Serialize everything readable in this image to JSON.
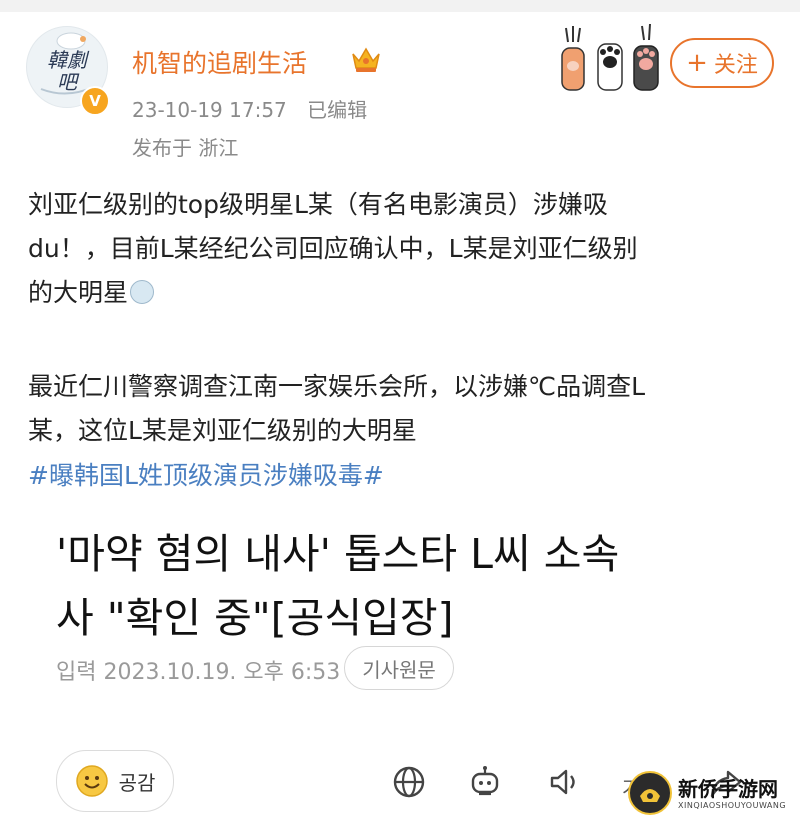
{
  "colors": {
    "accent": "#e8742c",
    "link": "#4a7fc1",
    "muted": "#8a8a8a"
  },
  "author": {
    "avatar_text": "韓劇\n吧",
    "verified_badge": "V",
    "name": "机智的追剧生活",
    "crown_icon": "crown-icon",
    "timestamp": "23-10-19 17:57",
    "edited": "已编辑",
    "location": "发布于 浙江"
  },
  "follow_button": {
    "plus": "+",
    "label": "关注"
  },
  "post": {
    "lines": [
      "刘亚仁级别的top级明星L某（有名电影演员）涉嫌吸",
      "du！，目前L某经纪公司回应确认中，L某是刘亚仁级别",
      "的大明星",
      "最近仁川警察调查江南一家娱乐会所，以涉嫌℃品调查L",
      "某，这位L某是刘亚仁级别的大明星"
    ],
    "hashtag": "#曝韩国L姓顶级演员涉嫌吸毒#"
  },
  "article": {
    "headline_line1": "'마약 혐의 내사' 톱스타 L씨 소속",
    "headline_line2": "사 \"확인 중\"[공식입장]",
    "date": "입력 2023.10.19. 오후 6:53",
    "original_button": "기사원문"
  },
  "toolbar": {
    "like_label": "공감",
    "font_label": "가가",
    "icons": [
      "globe-icon",
      "robot-icon",
      "speaker-icon",
      "share-icon"
    ]
  },
  "watermark": {
    "name": "新侨手游网",
    "sub": "XINQIAOSHOUYOUWANG"
  }
}
